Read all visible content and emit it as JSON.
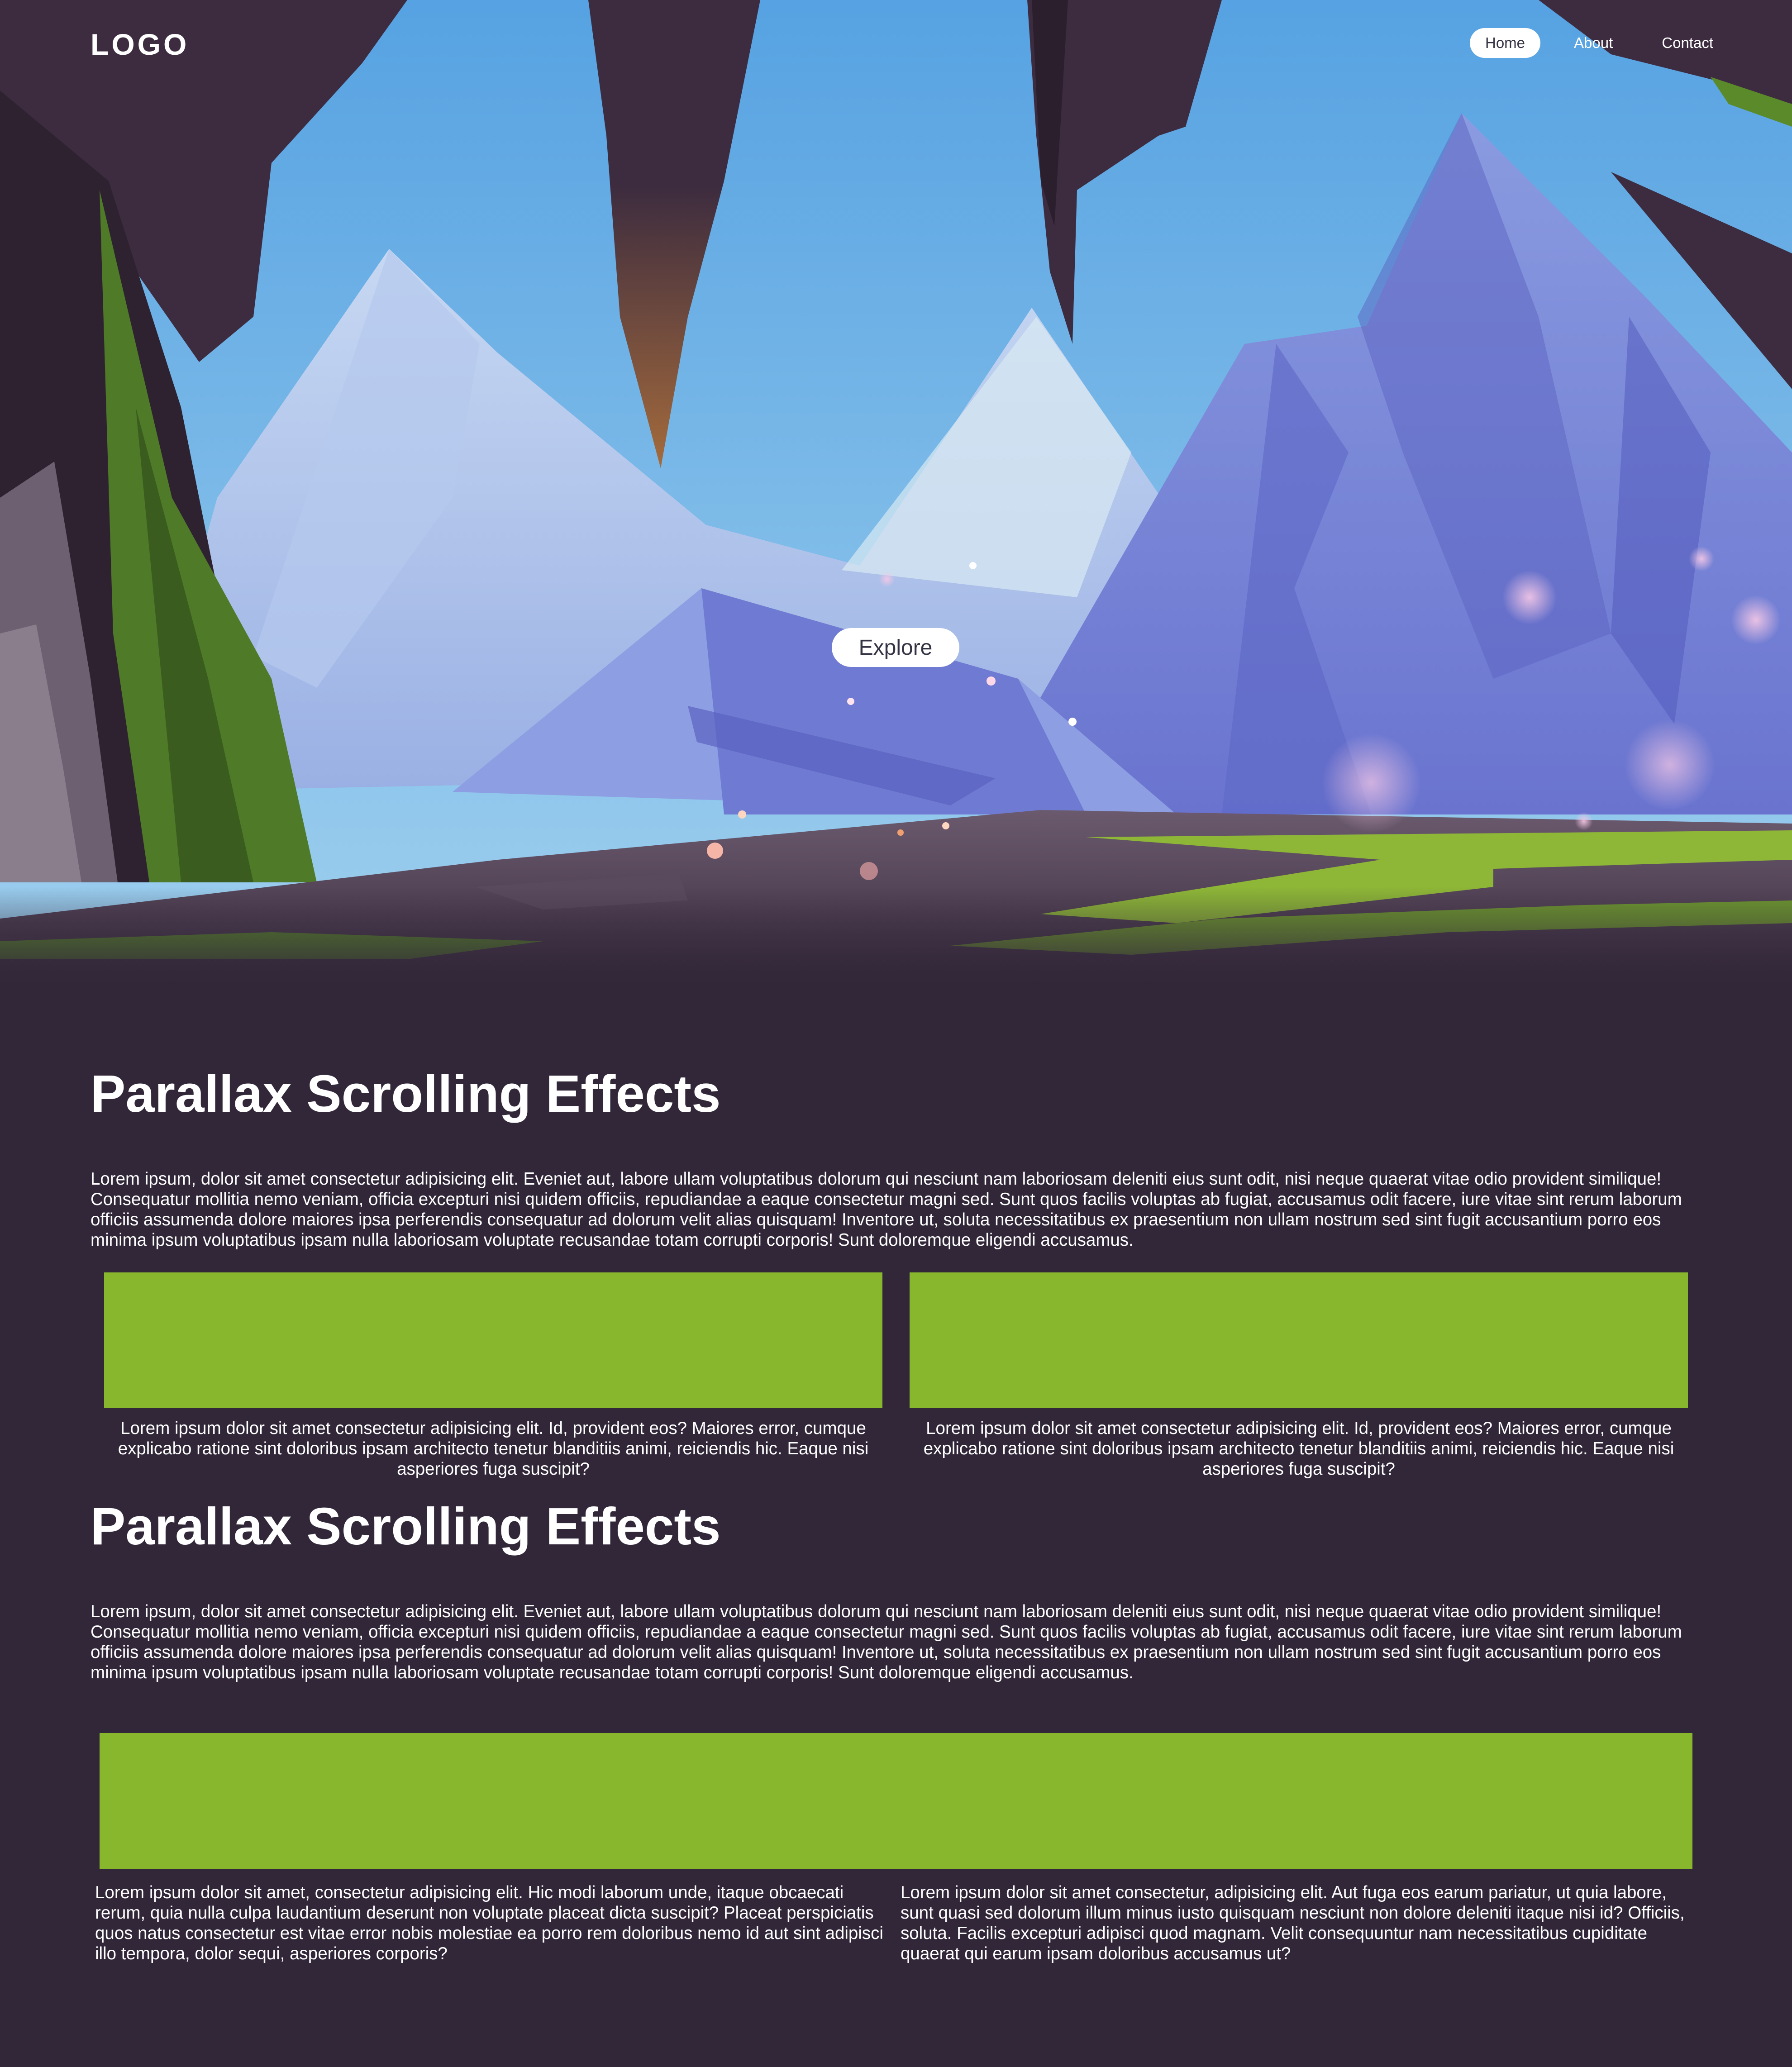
{
  "header": {
    "logo": "LOGO",
    "nav": [
      {
        "label": "Home",
        "active": true
      },
      {
        "label": "About",
        "active": false
      },
      {
        "label": "Contact",
        "active": false
      }
    ]
  },
  "hero": {
    "explore_label": "Explore",
    "colors": {
      "sky_top": "#56a2e2",
      "sky_bottom": "#8ec6ec",
      "rock": "#3d2c3f",
      "grass": "#4f7a28",
      "mountain": "#7380d4"
    }
  },
  "section1": {
    "title": "Parallax Scrolling Effects",
    "text": "Lorem ipsum, dolor sit amet consectetur adipisicing elit. Eveniet aut, labore ullam voluptatibus dolorum qui nesciunt nam laboriosam deleniti eius sunt odit, nisi neque quaerat vitae odio provident similique! Consequatur mollitia nemo veniam, officia excepturi nisi quidem officiis, repudiandae a eaque consectetur magni sed. Sunt quos facilis voluptas ab fugiat, accusamus odit facere, iure vitae sint rerum laborum officiis assumenda dolore maiores ipsa perferendis consequatur ad dolorum velit alias quisquam! Inventore ut, soluta necessitatibus ex praesentium non ullam nostrum sed sint fugit accusantium porro eos minima ipsum voluptatibus ipsam nulla laboriosam voluptate recusandae totam corrupti corporis! Sunt doloremque eligendi accusamus.",
    "cards": [
      {
        "caption": "Lorem ipsum dolor sit amet consectetur adipisicing elit. Id, provident eos? Maiores error, cumque explicabo ratione sint doloribus ipsam architecto tenetur blanditiis animi, reiciendis hic. Eaque nisi asperiores fuga suscipit?"
      },
      {
        "caption": "Lorem ipsum dolor sit amet consectetur adipisicing elit. Id, provident eos? Maiores error, cumque explicabo ratione sint doloribus ipsam architecto tenetur blanditiis animi, reiciendis hic. Eaque nisi asperiores fuga suscipit?"
      }
    ]
  },
  "section2": {
    "title": "Parallax Scrolling Effects",
    "text": "Lorem ipsum, dolor sit amet consectetur adipisicing elit. Eveniet aut, labore ullam voluptatibus dolorum qui nesciunt nam laboriosam deleniti eius sunt odit, nisi neque quaerat vitae odio provident similique! Consequatur mollitia nemo veniam, officia excepturi nisi quidem officiis, repudiandae a eaque consectetur magni sed. Sunt quos facilis voluptas ab fugiat, accusamus odit facere, iure vitae sint rerum laborum officiis assumenda dolore maiores ipsa perferendis consequatur ad dolorum velit alias quisquam! Inventore ut, soluta necessitatibus ex praesentium non ullam nostrum sed sint fugit accusantium porro eos minima ipsum voluptatibus ipsam nulla laboriosam voluptate recusandae totam corrupti corporis! Sunt doloremque eligendi accusamus.",
    "columns": [
      "Lorem ipsum dolor sit amet, consectetur adipisicing elit. Hic modi laborum unde, itaque obcaecati rerum, quia nulla culpa laudantium deserunt non voluptate placeat dicta suscipit? Placeat perspiciatis quos natus consectetur est vitae error nobis molestiae ea porro rem doloribus nemo id aut sint adipisci illo tempora, dolor sequi, asperiores corporis?",
      "Lorem ipsum dolor sit amet consectetur, adipisicing elit. Aut fuga eos earum pariatur, ut quia labore, sunt quasi sed dolorum illum minus iusto quisquam nesciunt non dolore deleniti itaque nisi id? Officiis, soluta. Facilis excepturi adipisci quod magnam. Velit consequuntur nam necessitatibus cupiditate quaerat qui earum ipsam doloribus accusamus ut?"
    ]
  },
  "colors": {
    "background": "#312739",
    "accent_green": "#88b72d",
    "text": "#ffffff"
  }
}
